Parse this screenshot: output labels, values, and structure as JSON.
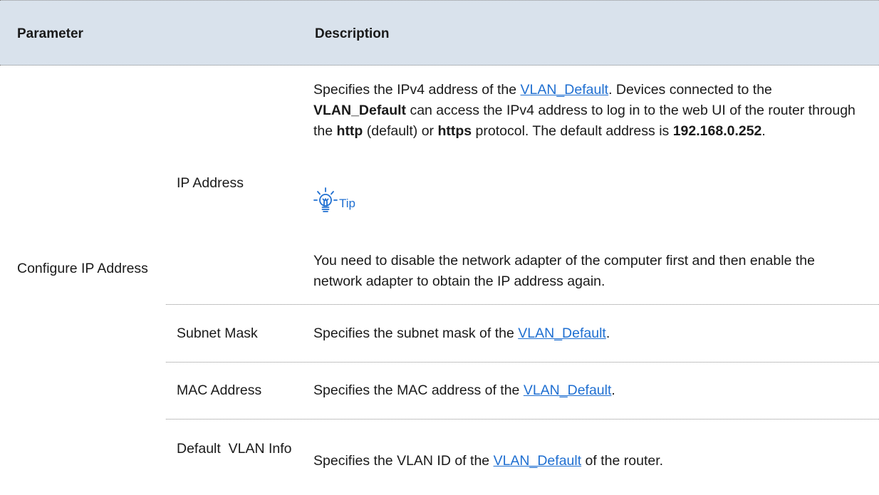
{
  "header": {
    "col1": "Parameter",
    "col2": "Description"
  },
  "group_label": "Configure IP Address",
  "link_text": "VLAN_Default",
  "rows": {
    "ip": {
      "name": "IP Address",
      "d1": "Specifies the IPv4 address of the ",
      "d2": ". Devices connected to the ",
      "d3": "VLAN_Default",
      "d4": " can access the IPv4 address to log in to the web UI of the router through the ",
      "d5": "http",
      "d6": " (default) or ",
      "d7": "https",
      "d8": " protocol. The default address is ",
      "d9": "192.168.0.252",
      "d10": ".",
      "tip_label": "Tip",
      "tip_text": "You need to disable the network adapter of the computer first and then enable the network adapter to obtain the IP address again."
    },
    "subnet": {
      "name": "Subnet Mask",
      "pre": "Specifies the subnet mask of the ",
      "post": "."
    },
    "mac": {
      "name": "MAC Address",
      "pre": "Specifies the MAC address of the ",
      "post": "."
    },
    "vlan": {
      "name": "Default  VLAN Info",
      "pre": "Specifies the VLAN ID of the ",
      "post": " of the router."
    }
  },
  "colors": {
    "header_bg": "#d9e2ec",
    "link": "#1f6fd1"
  },
  "icons": {
    "tip": "lightbulb-icon"
  }
}
